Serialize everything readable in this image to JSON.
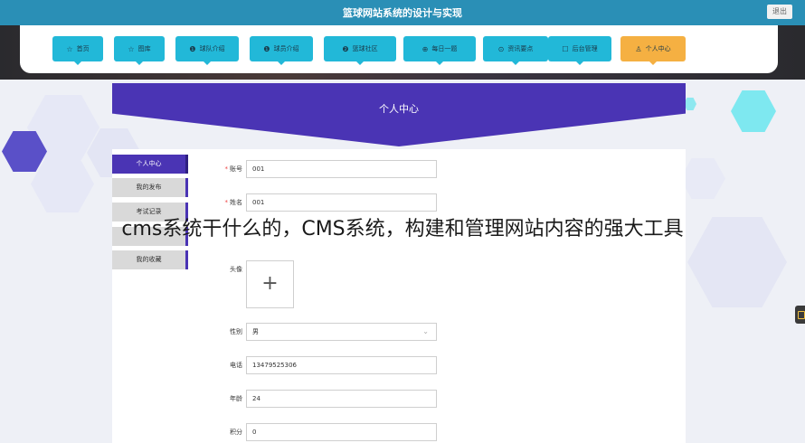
{
  "header": {
    "title": "篮球网站系统的设计与实现",
    "logout_label": "退出"
  },
  "nav": {
    "items": [
      {
        "label": "首页",
        "icon": "☆"
      },
      {
        "label": "图库",
        "icon": "☆"
      },
      {
        "label": "球队介绍",
        "icon": "❶"
      },
      {
        "label": "球员介绍",
        "icon": "❶"
      },
      {
        "label": "篮球社区",
        "icon": "❷"
      },
      {
        "label": "每日一题",
        "icon": "⊕"
      },
      {
        "label": "资讯要点",
        "icon": "⊙"
      },
      {
        "label": "后台管理",
        "icon": "☐"
      },
      {
        "label": "个人中心",
        "icon": "♙",
        "active": true
      }
    ]
  },
  "hero": {
    "title": "个人中心"
  },
  "sidebar": {
    "items": [
      {
        "label": "个人中心",
        "active": true
      },
      {
        "label": "我的发布"
      },
      {
        "label": "考试记录"
      },
      {
        "label": ""
      },
      {
        "label": "我的收藏"
      }
    ]
  },
  "form": {
    "account": {
      "label": "账号",
      "value": "001",
      "required": true
    },
    "name": {
      "label": "姓名",
      "value": "001",
      "required": true
    },
    "avatar": {
      "label": "头像",
      "upload_symbol": "+"
    },
    "gender": {
      "label": "性别",
      "value": "男"
    },
    "phone": {
      "label": "电话",
      "value": "13479525306"
    },
    "age": {
      "label": "年龄",
      "value": "24"
    },
    "points": {
      "label": "积分",
      "value": "0"
    }
  },
  "overlay_caption": "cms系统干什么的，CMS系统，构建和管理网站内容的强大工具",
  "colors": {
    "topbar": "#2a8fb6",
    "nav_item": "#22b8d8",
    "nav_active": "#f5b042",
    "primary": "#4a34b4"
  }
}
